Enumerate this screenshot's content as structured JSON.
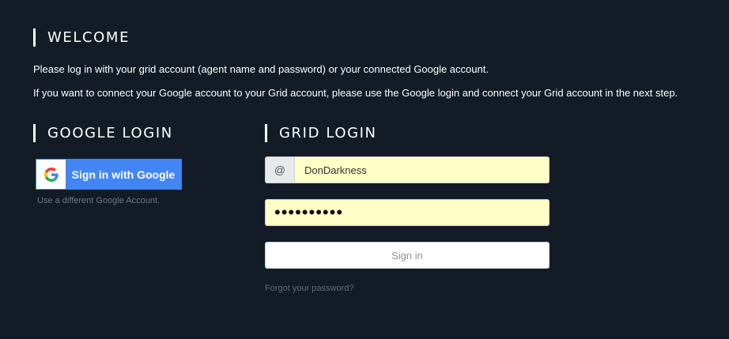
{
  "welcome": {
    "title": "WELCOME",
    "line1": "Please log in with your grid account (agent name and password) or your connected Google account.",
    "line2": "If you want to connect your Google account to your Grid account, please use the Google login and connect your Grid account in the next step."
  },
  "google": {
    "title": "GOOGLE LOGIN",
    "button_label": "Sign in with Google",
    "alt_account": "Use a different Google Account.",
    "icon": "google-g-icon"
  },
  "grid": {
    "title": "GRID LOGIN",
    "user_addon": "@",
    "username_value": "DonDarkness",
    "password_value": "••••••••••",
    "signin_label": "Sign in",
    "forgot_label": "Forgot your password?"
  },
  "colors": {
    "background": "#131c26",
    "google_blue": "#4285f4",
    "autofill": "#fefec6"
  }
}
